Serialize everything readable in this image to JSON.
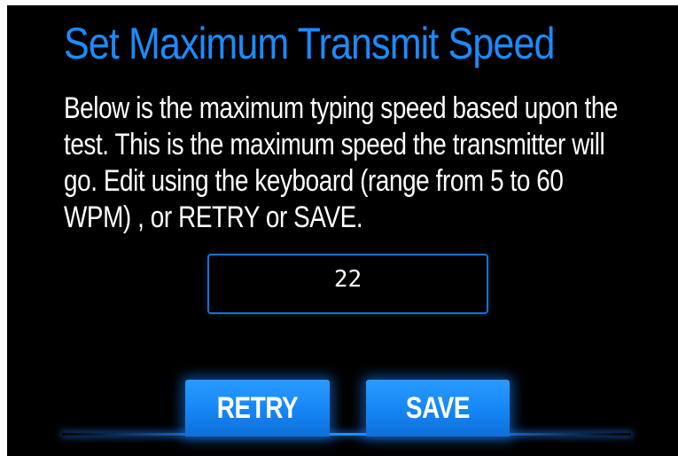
{
  "screen": {
    "title": "Set Maximum Transmit Speed",
    "description": "Below is the maximum typing speed based upon the test. This is the maximum speed the transmitter will go. Edit using the keyboard (range from 5 to 60 WPM) , or RETRY or SAVE."
  },
  "speed_input": {
    "value": "22"
  },
  "buttons": {
    "retry_label": "RETRY",
    "save_label": "SAVE"
  },
  "colors": {
    "background": "#000000",
    "title": "#1a8cff",
    "accent": "#1585f5",
    "text": "#ffffff"
  }
}
